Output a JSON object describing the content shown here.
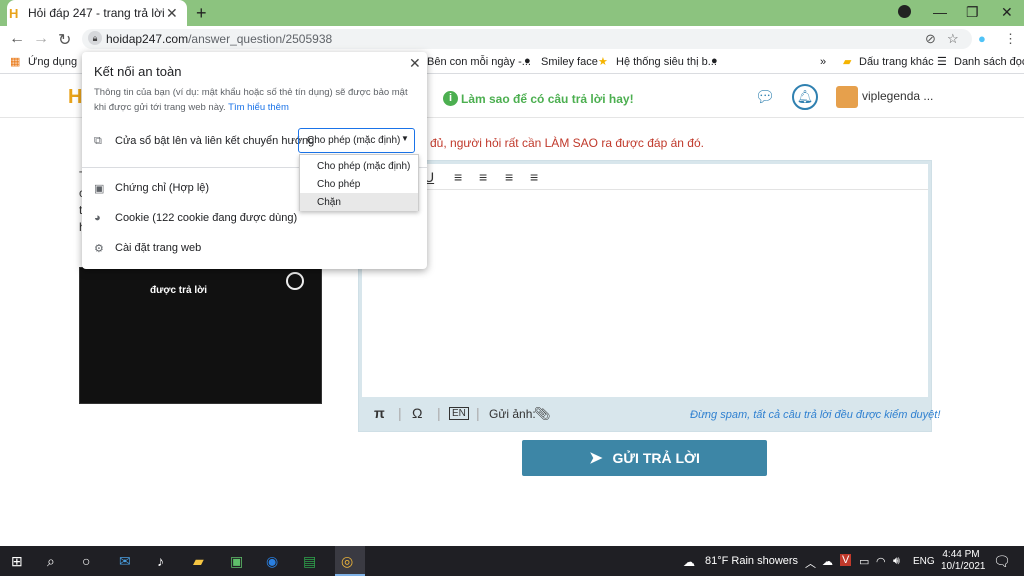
{
  "browser": {
    "tab_title": "Hỏi đáp 247 - trang trả lời",
    "url_domain": "hoidap247.com",
    "url_path": "/answer_question/2505938"
  },
  "bookmarks": {
    "apps": "Ứng dụng",
    "items": [
      "Bên con mỗi ngày -...",
      "Smiley face",
      "Hệ thống siêu thị b..."
    ],
    "other": "Dấu trang khác",
    "reading_list": "Danh sách đọc"
  },
  "popup": {
    "title": "Kết nối an toàn",
    "description": "Thông tin của bạn (ví dụ: mật khẩu hoặc số thẻ tín dụng) sẽ được bảo mật khi được gửi tới trang web này.",
    "learn_more": "Tìm hiểu thêm",
    "popups_label": "Cửa sổ bật lên và liên kết chuyển hướng",
    "select_value": "Cho phép (mặc định)",
    "options": [
      "Cho phép (mặc định)",
      "Cho phép",
      "Chặn"
    ],
    "certificate": "Chứng chỉ (Hợp lệ)",
    "cookie": "Cookie (122 cookie đang được dùng)",
    "site_settings": "Cài đặt trang web"
  },
  "page": {
    "hint": "Làm sao để có câu trả lời hay!",
    "username": "viplegenda ...",
    "notice": "ra đủ, người hỏi rất cần LÀM SAO ra được đáp án đó.",
    "image_label": "Gửi ảnh:",
    "spam_notice": "Đừng spam, tất cả câu trả lời đều được kiểm duyệt!",
    "submit": "GỬI TRẢ LỜI",
    "thumb_title": "được trả lời"
  },
  "taskbar": {
    "weather": "81°F  Rain showers",
    "lang": "ENG",
    "time": "4:44 PM",
    "date": "10/1/2021"
  }
}
